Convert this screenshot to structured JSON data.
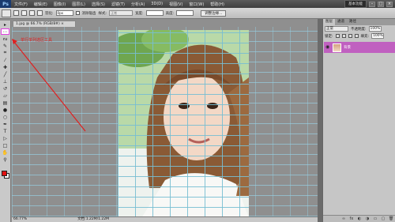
{
  "app": {
    "logo": "Ps",
    "workspace_label": "基本功能",
    "minimize": "–",
    "restore": "□",
    "close": "×"
  },
  "menu": [
    "文件(F)",
    "编辑(E)",
    "图像(I)",
    "图层(L)",
    "选择(S)",
    "滤镜(T)",
    "分析(A)",
    "3D(D)",
    "视图(V)",
    "窗口(W)",
    "帮助(H)"
  ],
  "options": {
    "feather_label": "羽化:",
    "feather_value": "0px",
    "antialias_label": "消除锯齿",
    "style_label": "样式:",
    "style_value": "正常",
    "width_label": "宽度:",
    "height_label": "高度:",
    "refine_label": "调整边缘..."
  },
  "document": {
    "tab_title": "1.jpg @ 66.7% (RGB/8#)",
    "close": "×"
  },
  "annotation": "单行单列选区工具",
  "status": {
    "zoom": "66.77%",
    "doc": "文档:1.22M/1.22M"
  },
  "panel": {
    "tabs": [
      "图层",
      "通道",
      "路径"
    ],
    "blend_mode": "正常",
    "opacity_label": "不透明度:",
    "opacity_value": "100%",
    "lock_label": "锁定:",
    "fill_label": "填充:",
    "fill_value": "100%",
    "layer_name": "背景"
  },
  "tools": [
    "move",
    "single-row-marquee",
    "lasso",
    "quick-select",
    "crop",
    "eyedropper",
    "healing",
    "brush",
    "clone-stamp",
    "history-brush",
    "eraser",
    "gradient",
    "blur",
    "dodge",
    "pen",
    "type",
    "path-select",
    "shape",
    "hand",
    "zoom"
  ],
  "colors": {
    "foreground": "#e11010",
    "background": "#ffffff",
    "layer_highlight": "#c060c0",
    "annotation": "#e02020"
  }
}
